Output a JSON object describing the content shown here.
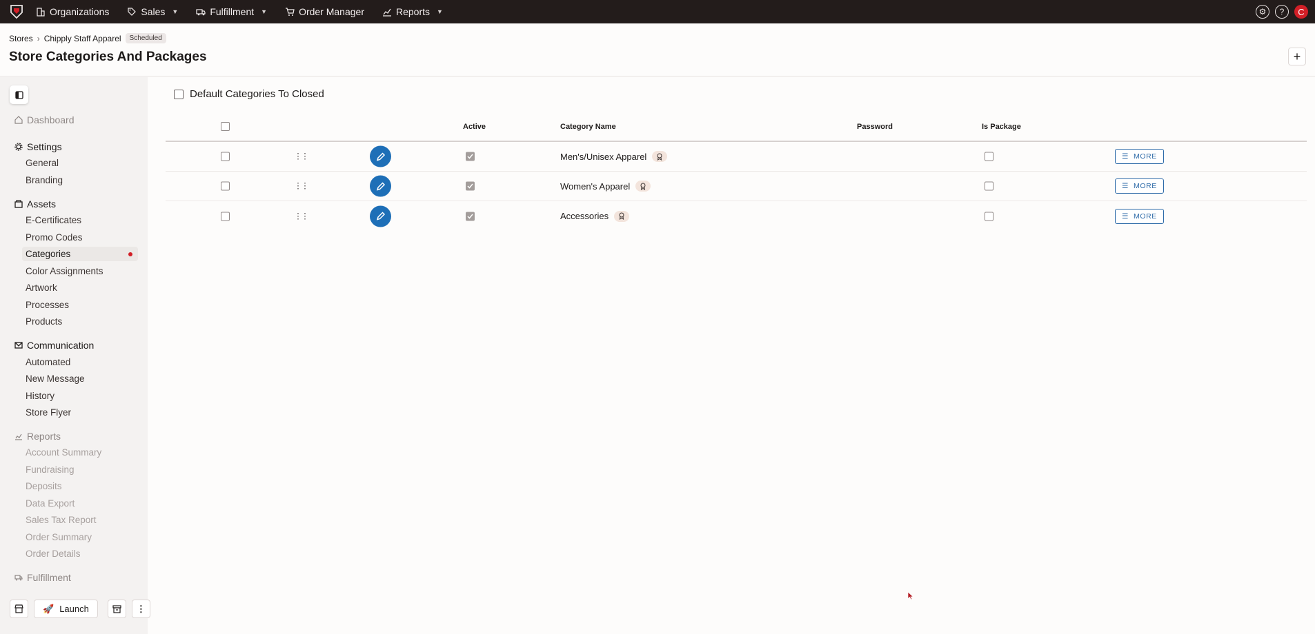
{
  "topnav": {
    "items": [
      {
        "label": "Organizations",
        "icon": "building-icon",
        "dropdown": false
      },
      {
        "label": "Sales",
        "icon": "tag-icon",
        "dropdown": true
      },
      {
        "label": "Fulfillment",
        "icon": "truck-icon",
        "dropdown": true
      },
      {
        "label": "Order Manager",
        "icon": "cart-icon",
        "dropdown": false
      },
      {
        "label": "Reports",
        "icon": "chart-icon",
        "dropdown": true
      }
    ],
    "avatar_initial": "C",
    "help_glyph": "?"
  },
  "breadcrumb": {
    "root": "Stores",
    "store": "Chipply Staff Apparel",
    "status_badge": "Scheduled"
  },
  "page_title": "Store Categories And Packages",
  "sidebar": {
    "dashboard": "Dashboard",
    "settings": {
      "label": "Settings",
      "items": [
        "General",
        "Branding"
      ]
    },
    "assets": {
      "label": "Assets",
      "items": [
        "E-Certificates",
        "Promo Codes",
        "Categories",
        "Color Assignments",
        "Artwork",
        "Processes",
        "Products"
      ],
      "active": "Categories"
    },
    "communication": {
      "label": "Communication",
      "items": [
        "Automated",
        "New Message",
        "History",
        "Store Flyer"
      ]
    },
    "reports": {
      "label": "Reports",
      "items": [
        "Account Summary",
        "Fundraising",
        "Deposits",
        "Data Export",
        "Sales Tax Report",
        "Order Summary",
        "Order Details"
      ]
    },
    "fulfillment": "Fulfillment",
    "launch_label": "Launch"
  },
  "main": {
    "default_closed_label": "Default Categories To Closed",
    "columns": {
      "active": "Active",
      "category_name": "Category Name",
      "password": "Password",
      "is_package": "Is Package"
    },
    "more_label": "MORE",
    "rows": [
      {
        "name": "Men's/Unisex Apparel",
        "active": true,
        "password": "",
        "is_package": false
      },
      {
        "name": "Women's Apparel",
        "active": true,
        "password": "",
        "is_package": false
      },
      {
        "name": "Accessories",
        "active": true,
        "password": "",
        "is_package": false
      }
    ]
  },
  "colors": {
    "topbar": "#231c1b",
    "accent": "#1e6fb7",
    "brand_red": "#d21f27",
    "sidebar_bg": "#f4f2f1"
  }
}
